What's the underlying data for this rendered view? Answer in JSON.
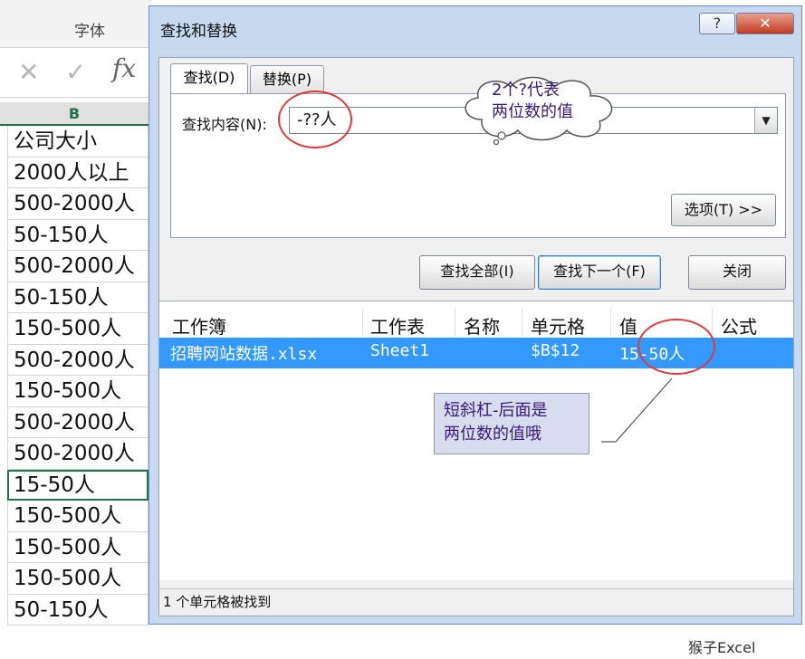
{
  "excel": {
    "ribbon_group": "字体",
    "column_letter": "B",
    "cells": [
      "公司大小",
      "2000人以上",
      "500-2000人",
      "50-150人",
      "500-2000人",
      "50-150人",
      "150-500人",
      "500-2000人",
      "150-500人",
      "500-2000人",
      "500-2000人",
      "15-50人",
      "150-500人",
      "150-500人",
      "150-500人",
      "50-150人"
    ],
    "selected_index": 11
  },
  "dialog": {
    "title": "查找和替换",
    "help_label": "?",
    "close_label": "✕",
    "tabs": {
      "find": "查找(D)",
      "replace": "替换(P)"
    },
    "find_label": "查找内容(N):",
    "find_value": "-??人",
    "options_button": "选项(T) >>",
    "buttons": {
      "find_all": "查找全部(I)",
      "find_next": "查找下一个(F)",
      "close": "关闭"
    },
    "results": {
      "headers": [
        "工作簿",
        "工作表",
        "名称",
        "单元格",
        "值",
        "公式"
      ],
      "row": {
        "workbook": "招聘网站数据.xlsx",
        "sheet": "Sheet1",
        "name": "",
        "cell": "$B$12",
        "value": "15-50人",
        "formula": ""
      }
    },
    "status": "1 个单元格被找到"
  },
  "annotations": {
    "cloud_line1": "2个?代表",
    "cloud_line2": "两位数的值",
    "callout_line1": "短斜杠-后面是",
    "callout_line2": "两位数的值哦"
  },
  "watermark": "猴子Excel",
  "colors": {
    "selection": "#3399ff",
    "ring": "#e03a3a",
    "excel_green": "#217346"
  }
}
